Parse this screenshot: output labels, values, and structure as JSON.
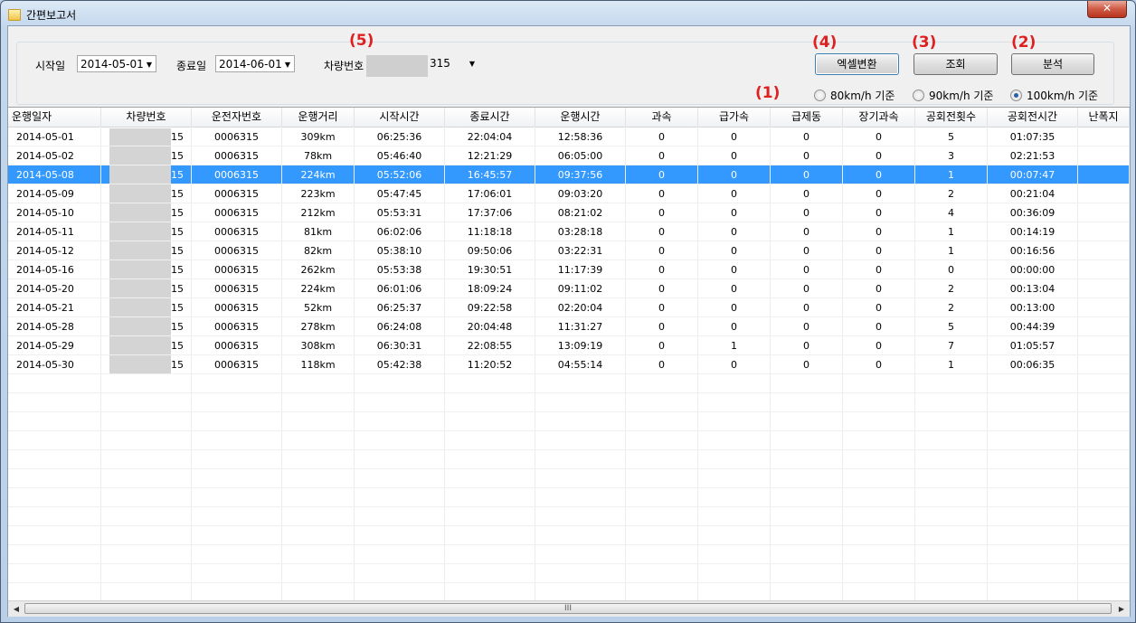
{
  "window": {
    "title": "간편보고서",
    "close_label": "✕"
  },
  "filters": {
    "start_label": "시작일",
    "start_value": "2014-05-01",
    "end_label": "종료일",
    "end_value": "2014-06-01",
    "vehicle_label": "차량번호",
    "vehicle_value": "315"
  },
  "buttons": {
    "excel": "엑셀변환",
    "query": "조회",
    "analyze": "분석"
  },
  "markers": {
    "m1": "(1)",
    "m2": "(2)",
    "m3": "(3)",
    "m4": "(4)",
    "m5": "(5)"
  },
  "speed_options": [
    {
      "label": "80km/h 기준",
      "selected": false
    },
    {
      "label": "90km/h 기준",
      "selected": false
    },
    {
      "label": "100km/h 기준",
      "selected": true
    }
  ],
  "table": {
    "columns": [
      "운행일자",
      "차량번호",
      "운전자번호",
      "운행거리",
      "시작시간",
      "종료시간",
      "운행시간",
      "과속",
      "급가속",
      "급제동",
      "장기과속",
      "공회전횟수",
      "공회전시간",
      "난폭지"
    ],
    "selected_row": 2,
    "rows": [
      [
        "2014-05-01",
        "15",
        "0006315",
        "309km",
        "06:25:36",
        "22:04:04",
        "12:58:36",
        "0",
        "0",
        "0",
        "0",
        "5",
        "01:07:35",
        ""
      ],
      [
        "2014-05-02",
        "15",
        "0006315",
        "78km",
        "05:46:40",
        "12:21:29",
        "06:05:00",
        "0",
        "0",
        "0",
        "0",
        "3",
        "02:21:53",
        ""
      ],
      [
        "2014-05-08",
        "15",
        "0006315",
        "224km",
        "05:52:06",
        "16:45:57",
        "09:37:56",
        "0",
        "0",
        "0",
        "0",
        "1",
        "00:07:47",
        ""
      ],
      [
        "2014-05-09",
        "15",
        "0006315",
        "223km",
        "05:47:45",
        "17:06:01",
        "09:03:20",
        "0",
        "0",
        "0",
        "0",
        "2",
        "00:21:04",
        ""
      ],
      [
        "2014-05-10",
        "15",
        "0006315",
        "212km",
        "05:53:31",
        "17:37:06",
        "08:21:02",
        "0",
        "0",
        "0",
        "0",
        "4",
        "00:36:09",
        ""
      ],
      [
        "2014-05-11",
        "15",
        "0006315",
        "81km",
        "06:02:06",
        "11:18:18",
        "03:28:18",
        "0",
        "0",
        "0",
        "0",
        "1",
        "00:14:19",
        ""
      ],
      [
        "2014-05-12",
        "15",
        "0006315",
        "82km",
        "05:38:10",
        "09:50:06",
        "03:22:31",
        "0",
        "0",
        "0",
        "0",
        "1",
        "00:16:56",
        ""
      ],
      [
        "2014-05-16",
        "15",
        "0006315",
        "262km",
        "05:53:38",
        "19:30:51",
        "11:17:39",
        "0",
        "0",
        "0",
        "0",
        "0",
        "00:00:00",
        ""
      ],
      [
        "2014-05-20",
        "15",
        "0006315",
        "224km",
        "06:01:06",
        "18:09:24",
        "09:11:02",
        "0",
        "0",
        "0",
        "0",
        "2",
        "00:13:04",
        ""
      ],
      [
        "2014-05-21",
        "15",
        "0006315",
        "52km",
        "06:25:37",
        "09:22:58",
        "02:20:04",
        "0",
        "0",
        "0",
        "0",
        "2",
        "00:13:00",
        ""
      ],
      [
        "2014-05-28",
        "15",
        "0006315",
        "278km",
        "06:24:08",
        "20:04:48",
        "11:31:27",
        "0",
        "0",
        "0",
        "0",
        "5",
        "00:44:39",
        ""
      ],
      [
        "2014-05-29",
        "15",
        "0006315",
        "308km",
        "06:30:31",
        "22:08:55",
        "13:09:19",
        "0",
        "1",
        "0",
        "0",
        "7",
        "01:05:57",
        ""
      ],
      [
        "2014-05-30",
        "15",
        "0006315",
        "118km",
        "05:42:38",
        "11:20:52",
        "04:55:14",
        "0",
        "0",
        "0",
        "0",
        "1",
        "00:06:35",
        ""
      ]
    ]
  },
  "scrollbar": {
    "left": "◀",
    "right": "▶",
    "grip": "III"
  }
}
